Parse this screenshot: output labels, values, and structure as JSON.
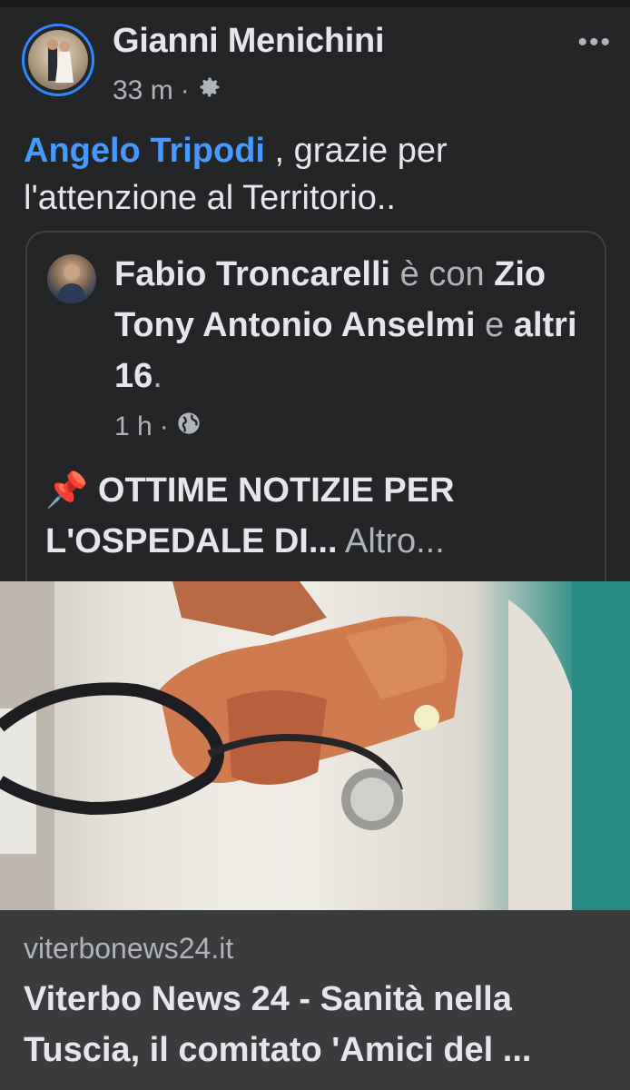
{
  "post": {
    "author": "Gianni Menichini",
    "time": "33 m",
    "separator": "·",
    "more_label": "•••",
    "mention": "Angelo Tripodi",
    "text_after_mention": " , grazie per l'attenzione al Territorio.."
  },
  "shared_post": {
    "author": "Fabio Troncarelli",
    "with_word": " è con ",
    "tagged": "Zio Tony Antonio Anselmi",
    "and_word": " e ",
    "others": "altri 16",
    "period": ".",
    "time": "1 h",
    "separator": "·",
    "body_emoji": "📌",
    "body": " OTTIME NOTIZIE PER L'OSPEDALE DI...",
    "see_more": " Altro..."
  },
  "link_preview": {
    "domain": "viterbonews24.it",
    "title": "Viterbo News 24 - Sanità nella Tuscia, il comitato 'Amici del ..."
  },
  "colors": {
    "background": "#242526",
    "mention": "#4599ff",
    "secondary_text": "#b0b3b8",
    "link_area": "#3a3b3c",
    "avatar_ring": "#2d88ff"
  },
  "icons": {
    "audience": "gear-icon",
    "shared_audience": "globe-icon",
    "more": "more-options-icon"
  }
}
